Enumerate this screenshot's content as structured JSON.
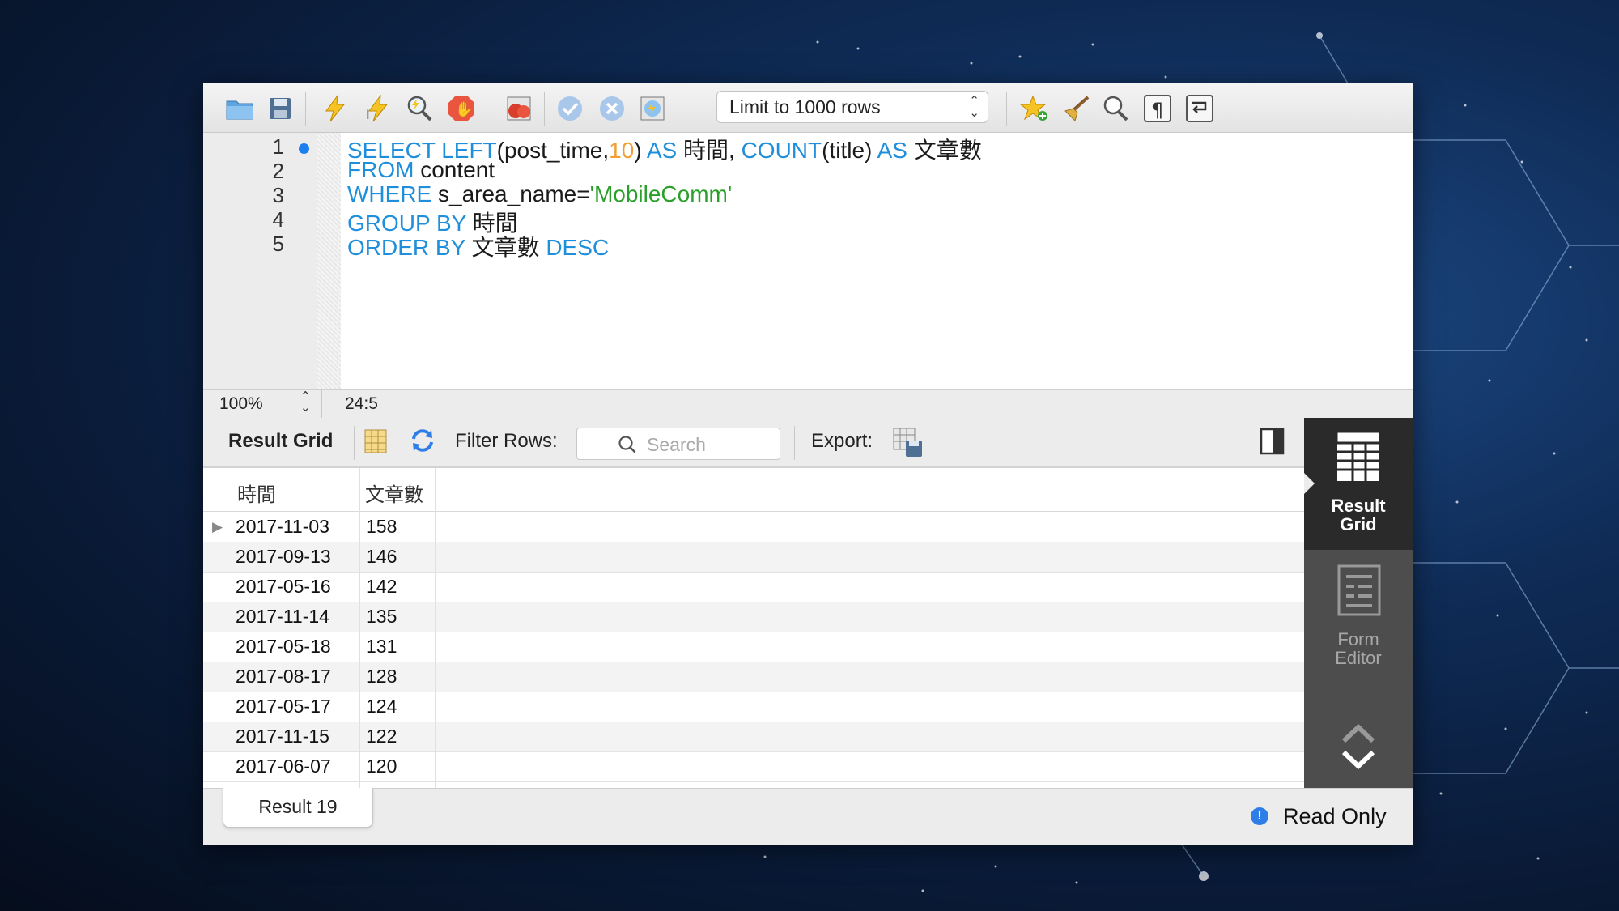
{
  "toolbar": {
    "limit_select": "Limit to 1000 rows"
  },
  "editor": {
    "line_numbers": [
      "1",
      "2",
      "3",
      "4",
      "5"
    ],
    "lines": [
      [
        "SELECT LEFT",
        "(post_time,",
        "10",
        ") ",
        "AS",
        " 時間, ",
        "COUNT",
        "(title) ",
        "AS",
        " 文章數"
      ],
      [
        "FROM",
        " content"
      ],
      [
        "WHERE",
        " s_area_name=",
        "'MobileComm'"
      ],
      [
        "GROUP BY",
        " 時間"
      ],
      [
        "ORDER BY",
        " 文章數 ",
        "DESC"
      ]
    ]
  },
  "status": {
    "zoom": "100%",
    "cursor_position": "24:5"
  },
  "result_toolbar": {
    "title": "Result Grid",
    "filter_label": "Filter Rows:",
    "search_placeholder": "Search",
    "export_label": "Export:"
  },
  "grid": {
    "columns": [
      "時間",
      "文章數"
    ],
    "rows": [
      [
        "2017-11-03",
        "158"
      ],
      [
        "2017-09-13",
        "146"
      ],
      [
        "2017-05-16",
        "142"
      ],
      [
        "2017-11-14",
        "135"
      ],
      [
        "2017-05-18",
        "131"
      ],
      [
        "2017-08-17",
        "128"
      ],
      [
        "2017-05-17",
        "124"
      ],
      [
        "2017-11-15",
        "122"
      ],
      [
        "2017-06-07",
        "120"
      ]
    ]
  },
  "side_panel": {
    "result_grid_line1": "Result",
    "result_grid_line2": "Grid",
    "form_editor_line1": "Form",
    "form_editor_line2": "Editor"
  },
  "bottom": {
    "result_tab": "Result 19",
    "read_only": "Read Only"
  },
  "colors": {
    "keyword": "#1f8fdb",
    "number": "#f0a032",
    "string": "#2aa02a",
    "accent": "#1b7ff0"
  }
}
